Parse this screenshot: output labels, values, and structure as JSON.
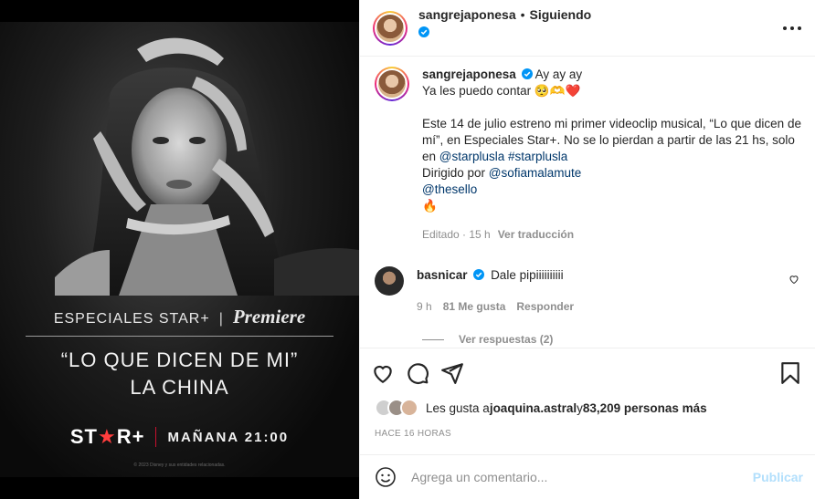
{
  "poster": {
    "brand_text": "ESPECIALES STAR+",
    "separator": "|",
    "premiere": "Premiere",
    "title_line1": "“LO QUE DICEN DE MI”",
    "title_line2": "LA CHINA",
    "logo_star_text": "ST",
    "logo_star": "★",
    "logo_plus": "R+",
    "air_time": "MAÑANA 21:00",
    "legal": "© 2023 Disney y sus entidades relacionadas."
  },
  "header": {
    "username": "sangrejaponesa",
    "dot": "•",
    "following": "Siguiendo"
  },
  "caption": {
    "username": "sangrejaponesa",
    "first_line": "Ay ay ay",
    "line2": "Ya les puedo contar 🥺🫶❤️",
    "para1": "Este 14 de julio estreno mi primer videoclip musical, “Lo que dicen de mí”, en Especiales Star+. No se lo pierdan a partir de las 21 hs, solo en ",
    "mention1": "@starplusla",
    "hashtag": "#starplusla",
    "directed_by": "Dirigido por ",
    "mention2": "@sofiamalamute",
    "mention3": "@thesello",
    "fire": "🔥",
    "edited": "Editado · 15 h",
    "translate": "Ver traducción"
  },
  "comment": {
    "username": "basnicar",
    "text": "Dale pipiiiiiiiiii",
    "age": "9 h",
    "likes": "81 Me gusta",
    "reply": "Responder",
    "view_replies": "Ver respuestas (2)"
  },
  "likes": {
    "prefix": "Les gusta a ",
    "user": "joaquina.astral",
    "middle": " y ",
    "count": "83,209 personas más"
  },
  "timestamp": "HACE 16 HORAS",
  "composer": {
    "placeholder": "Agrega un comentario...",
    "publish": "Publicar"
  },
  "colors": {
    "verified": "#0095f6",
    "link": "#00376b",
    "muted": "#8e8e8e",
    "publish_disabled": "#b2dffc",
    "star_red": "#ff3d3d"
  }
}
